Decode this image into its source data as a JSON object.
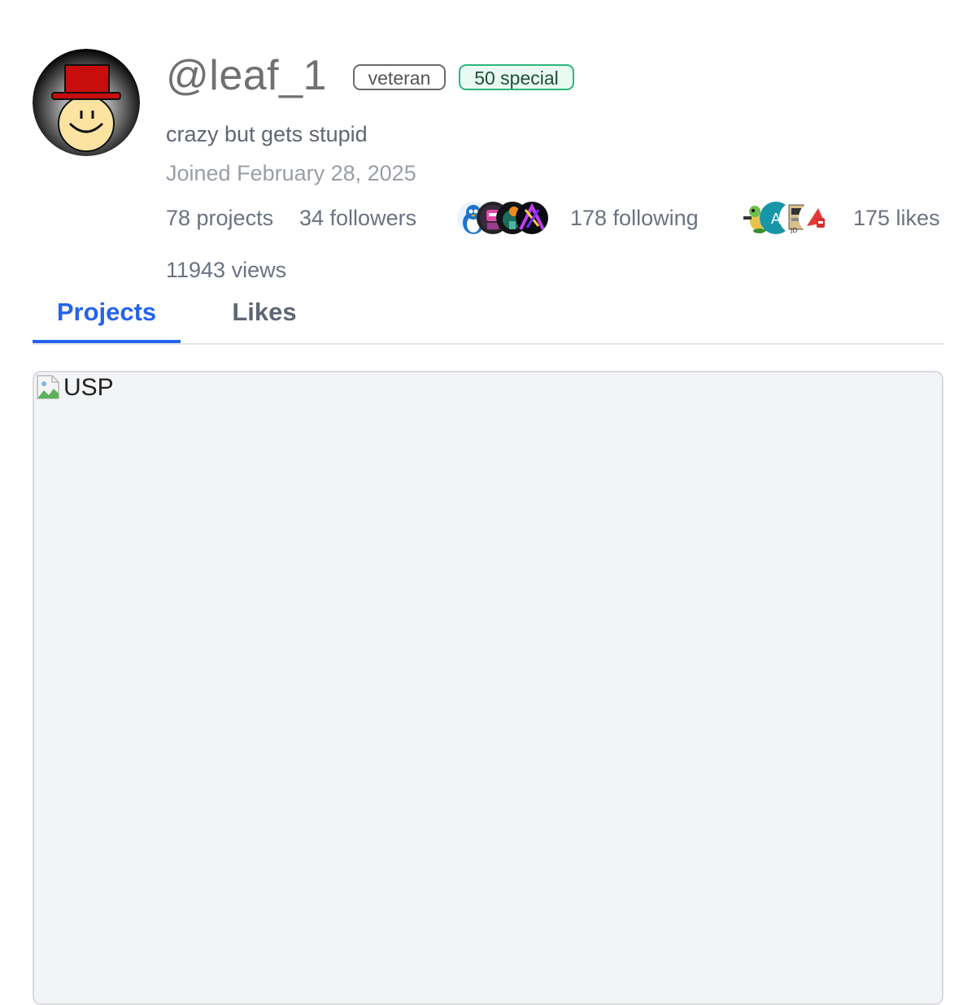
{
  "profile": {
    "username": "@leaf_1",
    "bio": "crazy but gets stupid",
    "joined": "Joined February 28, 2025",
    "badges": [
      {
        "label": "veteran"
      },
      {
        "label": "50 special"
      }
    ]
  },
  "stats": {
    "projects": "78 projects",
    "followers": "34 followers",
    "following": "178 following",
    "likes": "175 likes",
    "views": "11943 views"
  },
  "follower_avatars": [
    "penguin-icon",
    "robot-icon",
    "character-icon",
    "neon-icon"
  ],
  "following_avatars": [
    "turtle-icon",
    "letter-a-icon",
    "machine-icon",
    "fire-extinguisher-icon"
  ],
  "tabs": [
    {
      "label": "Projects",
      "active": true
    },
    {
      "label": "Likes",
      "active": false
    }
  ],
  "project": {
    "image_alt": "USP"
  },
  "colors": {
    "accent": "#2563eb",
    "special_badge_border": "#2cb67d",
    "card_background": "#f3f4f6"
  }
}
